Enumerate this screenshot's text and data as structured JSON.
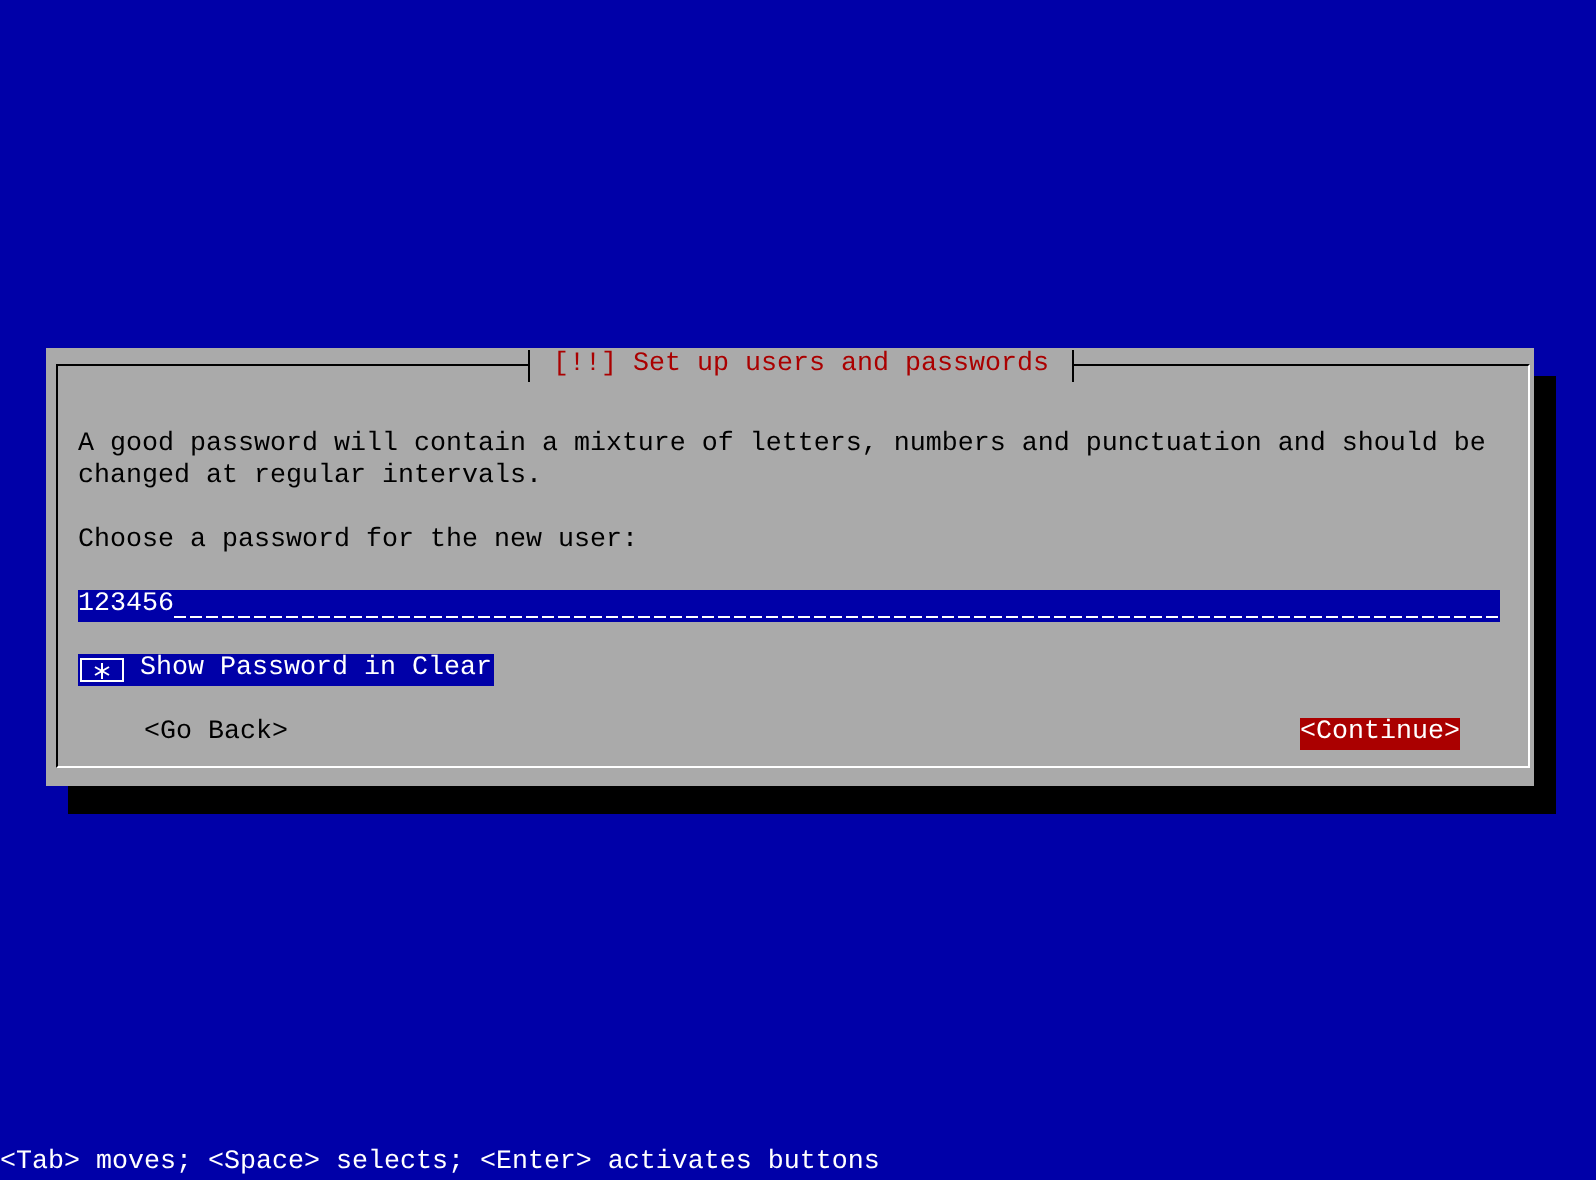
{
  "dialog": {
    "title": "[!!] Set up users and passwords",
    "description": "A good password will contain a mixture of letters, numbers and punctuation and should be changed at regular intervals.",
    "prompt": "Choose a password for the new user:",
    "password_field": {
      "value": "123456"
    },
    "checkbox": {
      "label": "Show Password in Clear",
      "checked": true,
      "highlighted": true
    },
    "buttons": [
      {
        "label": "<Go Back>",
        "selected": false
      },
      {
        "label": "<Continue>",
        "selected": true
      }
    ]
  },
  "status_bar": "<Tab> moves; <Space> selects; <Enter> activates buttons"
}
